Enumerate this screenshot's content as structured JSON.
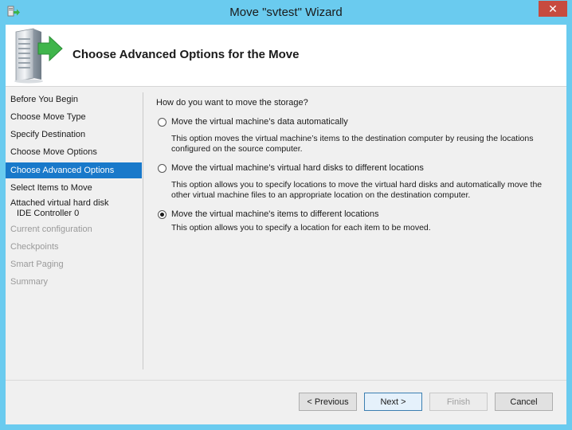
{
  "window": {
    "title": "Move \"svtest\" Wizard",
    "close_glyph": "✕",
    "title_icon": "wizard-app-icon",
    "close_icon": "close-icon"
  },
  "header": {
    "title": "Choose Advanced Options for the Move",
    "graphic": "server-move-arrow-icon"
  },
  "sidebar": {
    "items": [
      {
        "label": "Before You Begin",
        "state": "enabled"
      },
      {
        "label": "Choose Move Type",
        "state": "enabled"
      },
      {
        "label": "Specify Destination",
        "state": "enabled"
      },
      {
        "label": "Choose Move Options",
        "state": "enabled"
      },
      {
        "label": "Choose Advanced Options",
        "state": "selected"
      },
      {
        "label": "Select Items to Move",
        "state": "enabled"
      },
      {
        "label": "Attached virtual hard disk",
        "sublabel": "IDE Controller 0",
        "state": "enabled"
      },
      {
        "label": "Current configuration",
        "state": "disabled"
      },
      {
        "label": "Checkpoints",
        "state": "disabled"
      },
      {
        "label": "Smart Paging",
        "state": "disabled"
      },
      {
        "label": "Summary",
        "state": "disabled"
      }
    ]
  },
  "main": {
    "question": "How do you want to move the storage?",
    "options": [
      {
        "label": "Move the virtual machine’s data automatically",
        "description": "This option moves the virtual machine’s items to the destination computer by reusing the locations configured on the source computer.",
        "checked": false
      },
      {
        "label": "Move the virtual machine’s virtual hard disks to different locations",
        "description": "This option allows you to specify locations to move the virtual hard disks and automatically move the other virtual machine files to an appropriate location on the destination computer.",
        "checked": false
      },
      {
        "label": "Move the virtual machine's items to different locations",
        "description": "This option allows you to specify a location for each item to be moved.",
        "checked": true
      }
    ]
  },
  "footer": {
    "previous_label": "< Previous",
    "next_label": "Next >",
    "finish_label": "Finish",
    "cancel_label": "Cancel"
  },
  "colors": {
    "titlebar": "#6acbef",
    "selected_nav": "#1979ca",
    "close_button": "#c74b3f"
  }
}
